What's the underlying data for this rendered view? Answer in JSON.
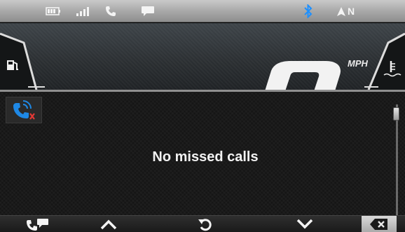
{
  "status_bar": {
    "battery_icon": "battery-icon",
    "signal_icon": "signal-strength-icon",
    "phone_icon": "phone-icon",
    "message_icon": "message-icon",
    "bluetooth_icon": "bluetooth-icon",
    "compass_text": "N",
    "colors": {
      "bluetooth": "#1e90ff",
      "text": "#f4f4f4"
    }
  },
  "dashboard": {
    "fuel_icon": "fuel-pump-icon",
    "speed_unit": "MPH",
    "coolant_icon": "coolant-temperature-icon"
  },
  "main": {
    "badge_icon": "missed-calls-icon",
    "empty_message": "No missed calls",
    "colors": {
      "badge_phone": "#1e88e5",
      "badge_x": "#e53935"
    }
  },
  "toolbar": {
    "buttons": [
      {
        "icon": "call-and-message-icon"
      },
      {
        "icon": "chevron-up-icon"
      },
      {
        "icon": "refresh-icon"
      },
      {
        "icon": "chevron-down-icon"
      },
      {
        "icon": "clear-backspace-icon"
      }
    ]
  }
}
